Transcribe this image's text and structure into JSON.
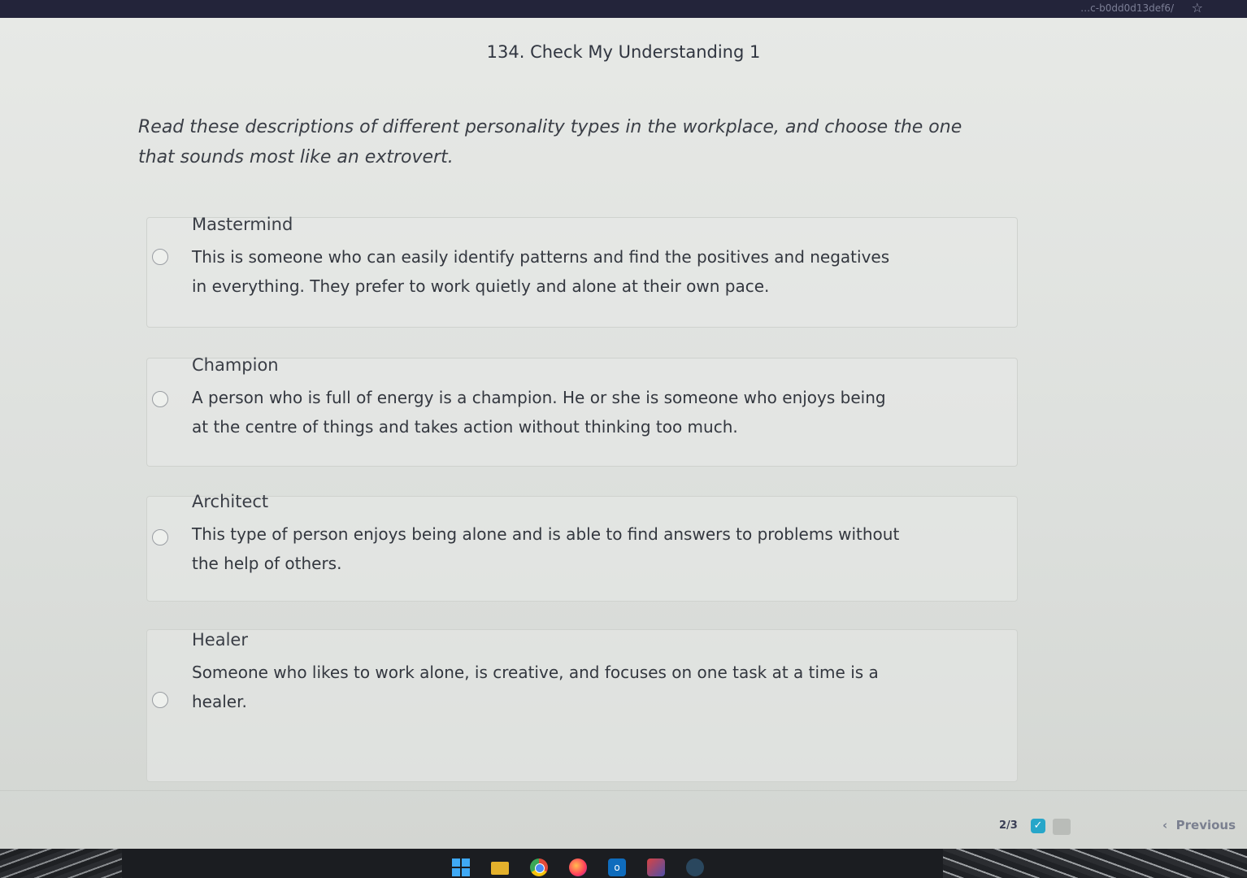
{
  "browser": {
    "url_fragment": "…c-b0dd0d13def6/",
    "bookmark_icon": "star-icon"
  },
  "question": {
    "title": "134. Check My Understanding 1",
    "prompt": "Read these descriptions of different personality types in the workplace, and choose the one that sounds most like an extrovert."
  },
  "options": [
    {
      "title": "Mastermind",
      "description": "This is someone who can easily identify patterns and find the positives and negatives in everything. They prefer to work quietly and alone at their own pace.",
      "selected": false
    },
    {
      "title": "Champion",
      "description": "A person who is full of energy is a champion. He or she is someone who enjoys being at the centre of things and takes action without thinking too much.",
      "selected": false
    },
    {
      "title": "Architect",
      "description": "This type of person enjoys being alone and is able to find answers to problems without the help of others.",
      "selected": false
    },
    {
      "title": "Healer",
      "description": "Someone who likes to work alone, is creative, and focuses on one task at a time is a healer.",
      "selected": false
    }
  ],
  "footer": {
    "pager": "2/3",
    "previous_label": "Previous",
    "check_color": "#27a6c9"
  },
  "taskbar": {
    "icons": [
      "windows-icon",
      "folder-icon",
      "chrome-icon",
      "firefox-icon",
      "outlook-icon",
      "app-icon",
      "steam-icon"
    ],
    "outlook_glyph": "o"
  }
}
